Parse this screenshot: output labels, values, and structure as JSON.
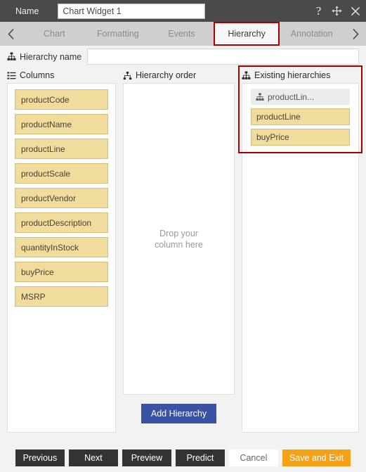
{
  "titlebar": {
    "name_label": "Name",
    "widget_name_value": "Chart Widget 1",
    "help_icon": "question-mark-icon",
    "move_icon": "move-arrows-icon",
    "close_icon": "close-x-icon"
  },
  "tabbar": {
    "prev_arrow": "chevron-left-icon",
    "next_arrow": "chevron-right-icon",
    "tabs": [
      {
        "label": "Chart",
        "active": false
      },
      {
        "label": "Formatting",
        "active": false
      },
      {
        "label": "Events",
        "active": false
      },
      {
        "label": "Hierarchy",
        "active": true
      },
      {
        "label": "Annotation",
        "active": false
      }
    ],
    "active_tab": "Hierarchy",
    "active_outline_color": "#a80000"
  },
  "hierarchy_name": {
    "label": "Hierarchy name",
    "icon": "sitemap-icon",
    "value": "",
    "placeholder": ""
  },
  "columns_panel": {
    "title": "Columns",
    "icon": "list-icon",
    "items": [
      "productCode",
      "productName",
      "productLine",
      "productScale",
      "productVendor",
      "productDescription",
      "quantityInStock",
      "buyPrice",
      "MSRP"
    ],
    "chip_color": "#f0dd9d",
    "chip_border_color": "#d6bf74"
  },
  "hierarchy_order_panel": {
    "title": "Hierarchy order",
    "icon": "hierarchy-icon",
    "dropzone_text": "Drop your\ncolumn here",
    "dropzone_line1": "Drop your",
    "dropzone_line2": "column here",
    "add_button_label": "Add Hierarchy",
    "add_button_color": "#3a52a4"
  },
  "existing_hierarchies_panel": {
    "title": "Existing hierarchies",
    "icon": "sitemap-icon",
    "highlight_color": "#a80000",
    "groups": [
      {
        "name": "productLin...",
        "icon": "sitemap-icon",
        "items": [
          "productLine",
          "buyPrice"
        ]
      }
    ]
  },
  "footer": {
    "buttons": [
      {
        "label": "Previous",
        "style": "dark"
      },
      {
        "label": "Next",
        "style": "dark"
      },
      {
        "label": "Preview",
        "style": "dark"
      },
      {
        "label": "Predict",
        "style": "dark"
      },
      {
        "label": "Cancel",
        "style": "light"
      },
      {
        "label": "Save and Exit",
        "style": "accent"
      }
    ]
  }
}
